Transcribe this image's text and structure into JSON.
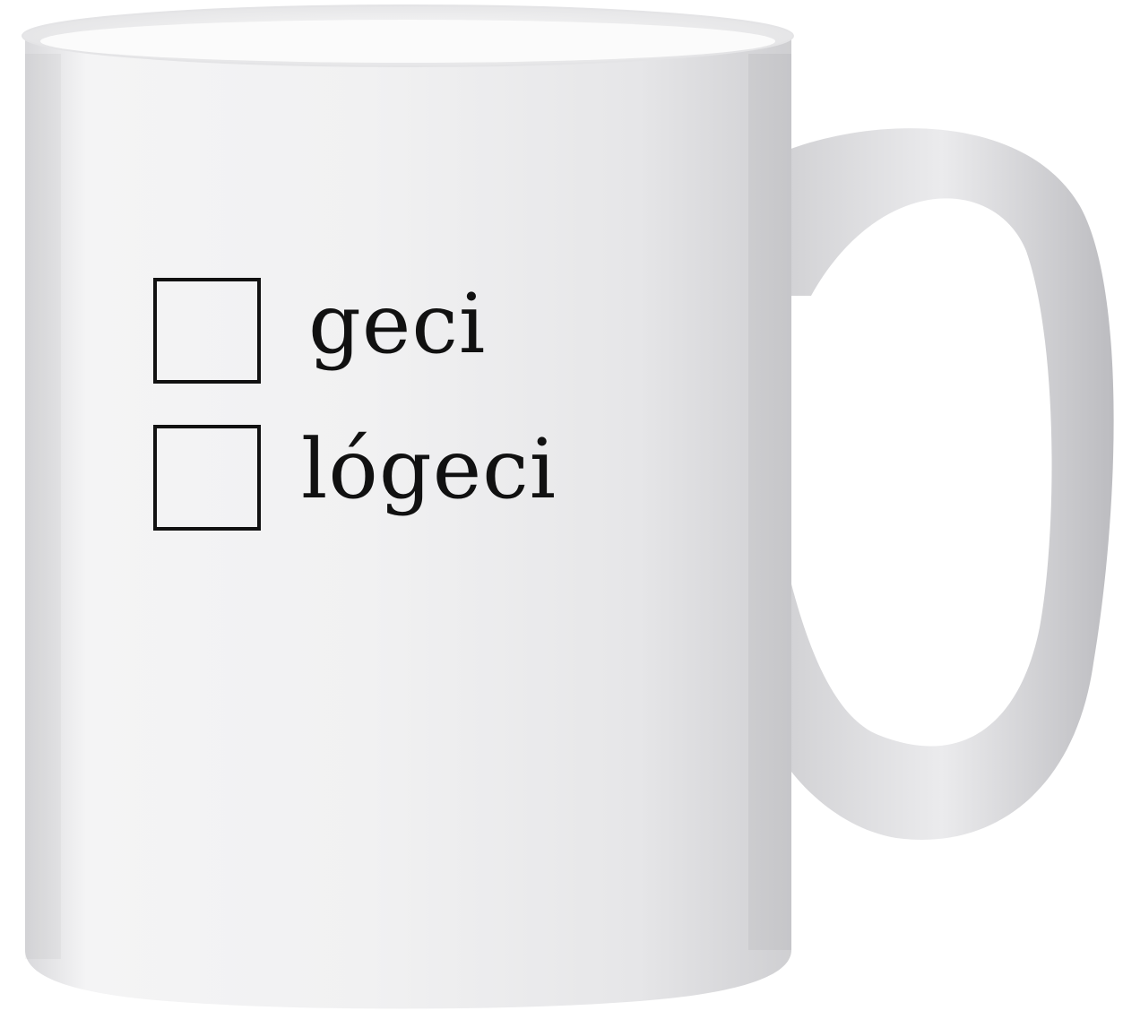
{
  "options": [
    {
      "label": "geci",
      "checked": false
    },
    {
      "label": "lógeci",
      "checked": false
    }
  ],
  "colors": {
    "background": "#ffffff",
    "mug_body": "#eeeeef",
    "mug_shadow": "#c9c9cc",
    "print_ink": "#111111"
  }
}
